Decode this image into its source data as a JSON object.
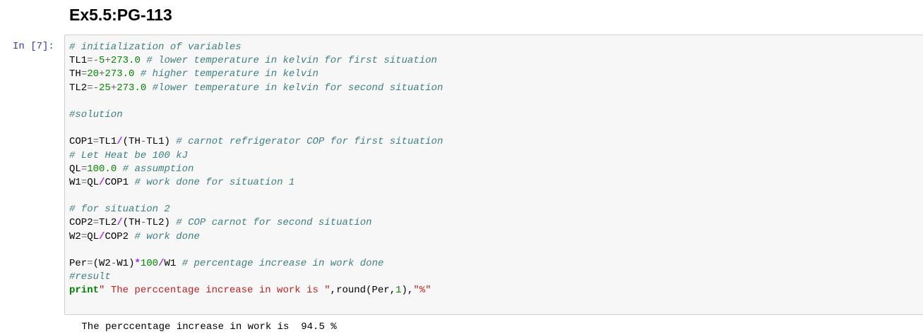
{
  "heading": "Ex5.5:PG-113",
  "cell": {
    "prompt": "In [7]:",
    "lines": [
      [
        {
          "t": "c",
          "v": "# initialization of variables"
        }
      ],
      [
        {
          "t": "n",
          "v": "TL1"
        },
        {
          "t": "o",
          "v": "=-"
        },
        {
          "t": "m",
          "v": "5"
        },
        {
          "t": "o",
          "v": "+"
        },
        {
          "t": "m",
          "v": "273.0"
        },
        {
          "t": "n",
          "v": " "
        },
        {
          "t": "c",
          "v": "# lower temperature in kelvin for first situation"
        }
      ],
      [
        {
          "t": "n",
          "v": "TH"
        },
        {
          "t": "o",
          "v": "="
        },
        {
          "t": "m",
          "v": "20"
        },
        {
          "t": "o",
          "v": "+"
        },
        {
          "t": "m",
          "v": "273.0"
        },
        {
          "t": "n",
          "v": " "
        },
        {
          "t": "c",
          "v": "# higher temperature in kelvin"
        }
      ],
      [
        {
          "t": "n",
          "v": "TL2"
        },
        {
          "t": "o",
          "v": "=-"
        },
        {
          "t": "m",
          "v": "25"
        },
        {
          "t": "o",
          "v": "+"
        },
        {
          "t": "m",
          "v": "273.0"
        },
        {
          "t": "n",
          "v": " "
        },
        {
          "t": "c",
          "v": "#lower temperature in kelvin for second situation"
        }
      ],
      [],
      [
        {
          "t": "c",
          "v": "#solution"
        }
      ],
      [],
      [
        {
          "t": "n",
          "v": "COP1"
        },
        {
          "t": "o",
          "v": "="
        },
        {
          "t": "n",
          "v": "TL1"
        },
        {
          "t": "om",
          "v": "/"
        },
        {
          "t": "n",
          "v": "("
        },
        {
          "t": "n",
          "v": "TH"
        },
        {
          "t": "o",
          "v": "-"
        },
        {
          "t": "n",
          "v": "TL1"
        },
        {
          "t": "n",
          "v": ") "
        },
        {
          "t": "c",
          "v": "# carnot refrigerator COP for first situation"
        }
      ],
      [
        {
          "t": "c",
          "v": "# Let Heat be 100 kJ"
        }
      ],
      [
        {
          "t": "n",
          "v": "QL"
        },
        {
          "t": "o",
          "v": "="
        },
        {
          "t": "m",
          "v": "100.0"
        },
        {
          "t": "n",
          "v": " "
        },
        {
          "t": "c",
          "v": "# assumption"
        }
      ],
      [
        {
          "t": "n",
          "v": "W1"
        },
        {
          "t": "o",
          "v": "="
        },
        {
          "t": "n",
          "v": "QL"
        },
        {
          "t": "om",
          "v": "/"
        },
        {
          "t": "n",
          "v": "COP1 "
        },
        {
          "t": "c",
          "v": "# work done for situation 1"
        }
      ],
      [],
      [
        {
          "t": "c",
          "v": "# for situation 2"
        }
      ],
      [
        {
          "t": "n",
          "v": "COP2"
        },
        {
          "t": "o",
          "v": "="
        },
        {
          "t": "n",
          "v": "TL2"
        },
        {
          "t": "om",
          "v": "/"
        },
        {
          "t": "n",
          "v": "("
        },
        {
          "t": "n",
          "v": "TH"
        },
        {
          "t": "o",
          "v": "-"
        },
        {
          "t": "n",
          "v": "TL2"
        },
        {
          "t": "n",
          "v": ") "
        },
        {
          "t": "c",
          "v": "# COP carnot for second situation"
        }
      ],
      [
        {
          "t": "n",
          "v": "W2"
        },
        {
          "t": "o",
          "v": "="
        },
        {
          "t": "n",
          "v": "QL"
        },
        {
          "t": "om",
          "v": "/"
        },
        {
          "t": "n",
          "v": "COP2 "
        },
        {
          "t": "c",
          "v": "# work done"
        }
      ],
      [],
      [
        {
          "t": "n",
          "v": "Per"
        },
        {
          "t": "o",
          "v": "="
        },
        {
          "t": "n",
          "v": "("
        },
        {
          "t": "n",
          "v": "W2"
        },
        {
          "t": "o",
          "v": "-"
        },
        {
          "t": "n",
          "v": "W1"
        },
        {
          "t": "n",
          "v": ")"
        },
        {
          "t": "om",
          "v": "*"
        },
        {
          "t": "m",
          "v": "100"
        },
        {
          "t": "om",
          "v": "/"
        },
        {
          "t": "n",
          "v": "W1 "
        },
        {
          "t": "c",
          "v": "# percentage increase in work done"
        }
      ],
      [
        {
          "t": "c",
          "v": "#result"
        }
      ],
      [
        {
          "t": "k",
          "v": "print"
        },
        {
          "t": "s",
          "v": "\" The perccentage increase in work is \""
        },
        {
          "t": "n",
          "v": ","
        },
        {
          "t": "n",
          "v": "round"
        },
        {
          "t": "n",
          "v": "("
        },
        {
          "t": "n",
          "v": "Per"
        },
        {
          "t": "n",
          "v": ","
        },
        {
          "t": "m",
          "v": "1"
        },
        {
          "t": "n",
          "v": "),"
        },
        {
          "t": "s",
          "v": "\"%\""
        }
      ]
    ]
  },
  "output": " The perccentage increase in work is  94.5 %",
  "colors": {
    "comment": "#408080",
    "number": "#008800",
    "string": "#ba2121",
    "keyword": "#008000",
    "operator_math": "#aa22ff",
    "prompt": "#303f9f",
    "cell_bg": "#f7f7f7",
    "cell_border": "#cfcfcf"
  }
}
